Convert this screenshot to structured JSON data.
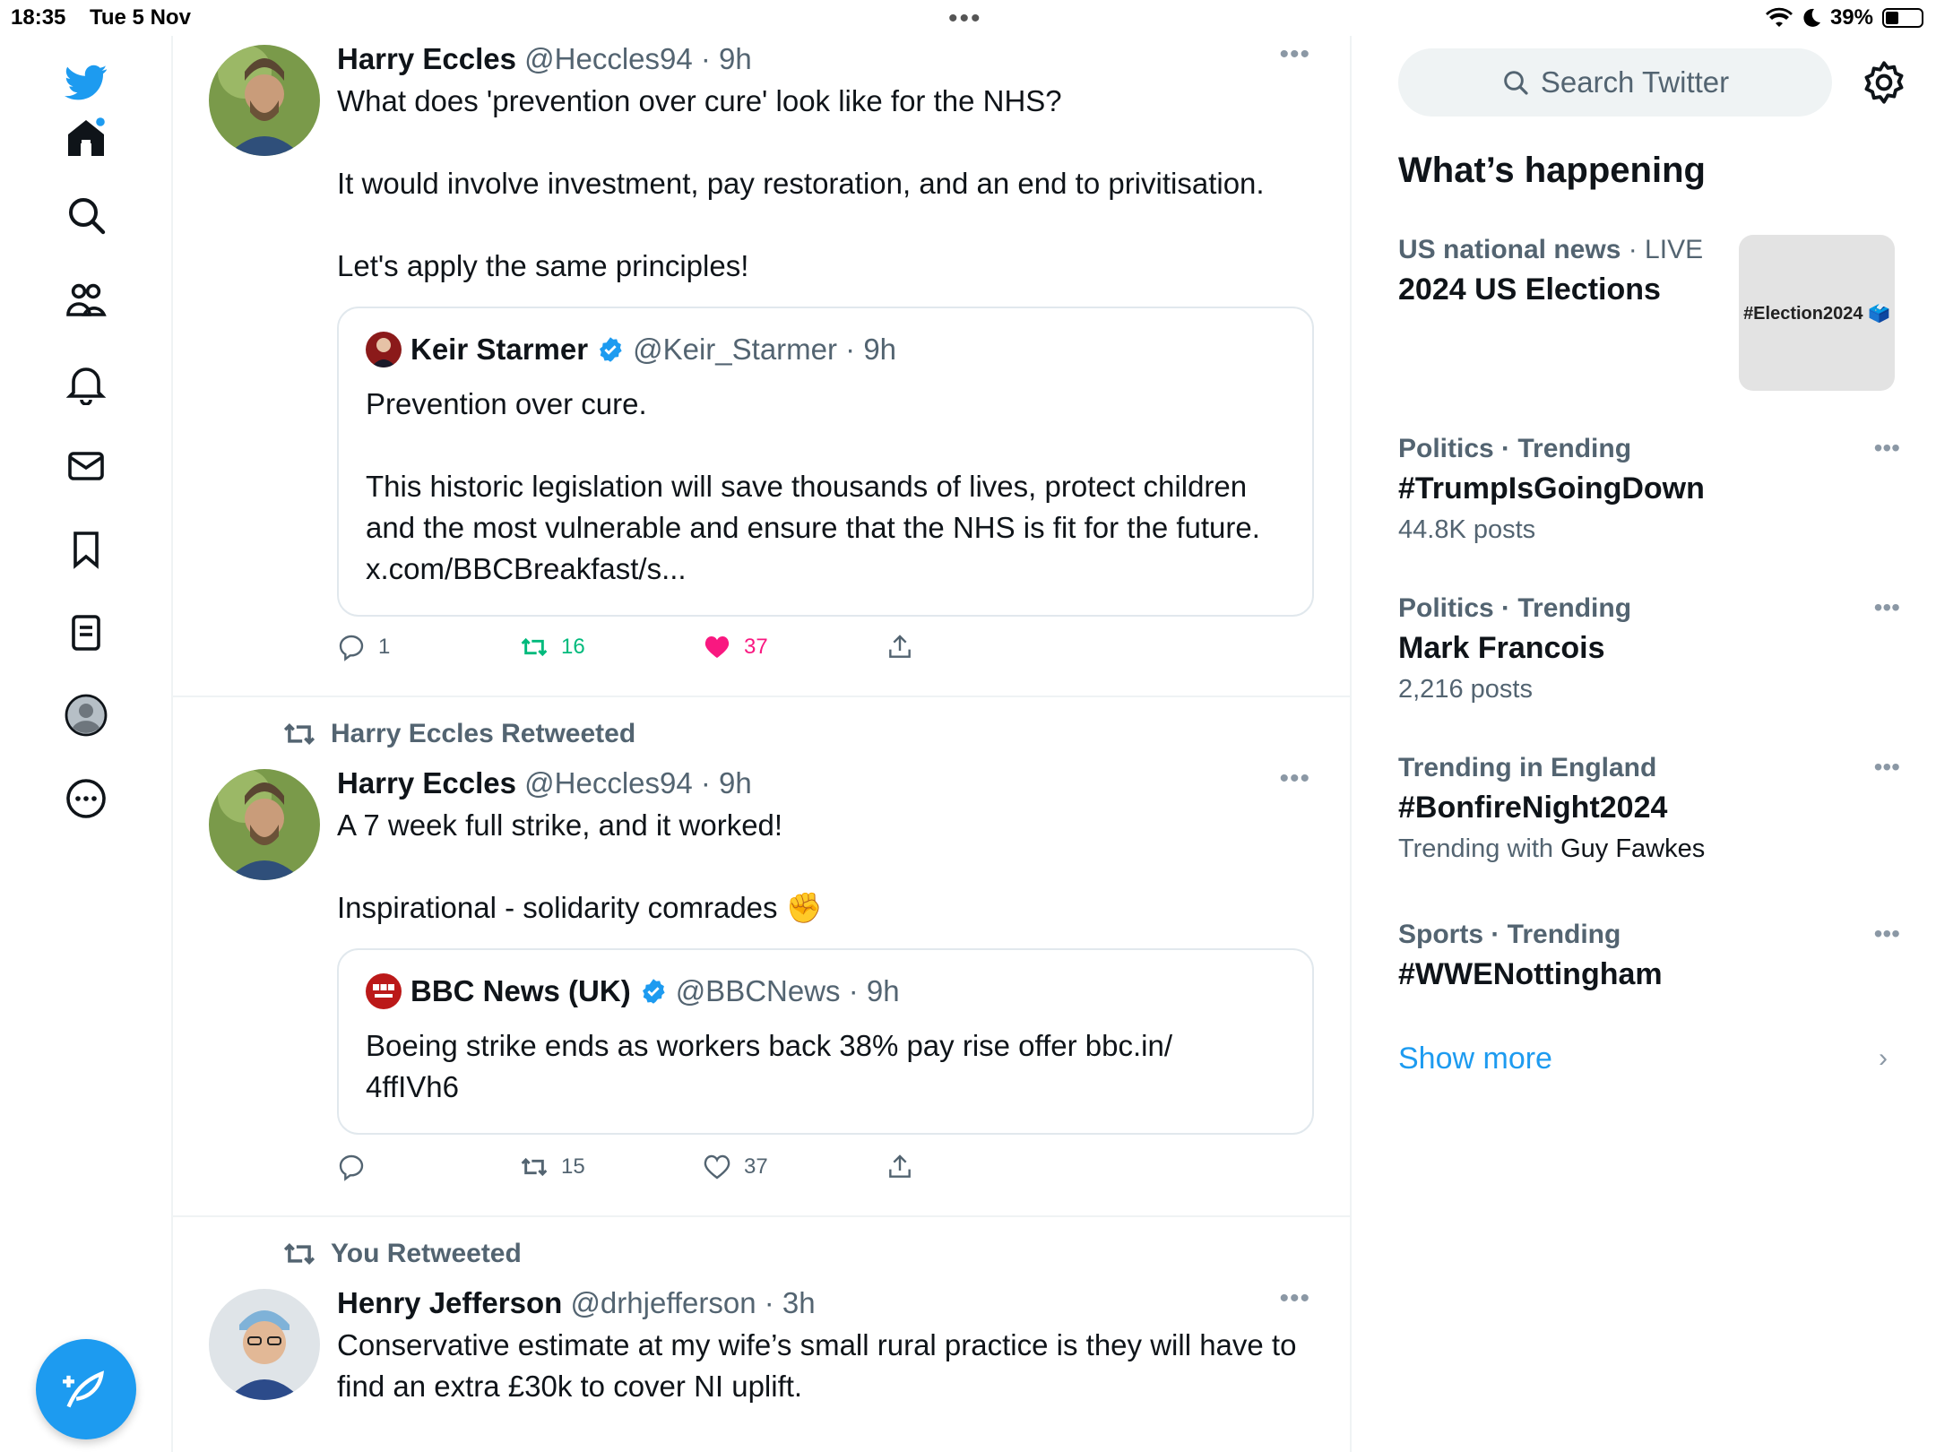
{
  "status": {
    "time": "18:35",
    "date": "Tue 5 Nov",
    "battery": "39%",
    "battery_level": 0.39
  },
  "nav": {
    "items": [
      "twitter-logo",
      "home",
      "explore",
      "communities",
      "notifications",
      "messages",
      "bookmarks",
      "lists",
      "profile",
      "more"
    ]
  },
  "search": {
    "placeholder": "Search Twitter"
  },
  "tweets": [
    {
      "name": "Harry Eccles",
      "meta": "@Heccles94 · 9h",
      "text": "What does 'prevention over cure' look like for the NHS?\n\nIt would involve investment, pay restoration, and an end to privitisation.\n\nLet's apply the same principles!",
      "quote": {
        "name": "Keir Starmer",
        "meta": "@Keir_Starmer · 9h",
        "text": "Prevention over cure.\n\nThis historic legislation will save thousands of lives, protect children and the most vulnerable and ensure that the NHS is fit for the future. x.com/BBCBreakfast/s..."
      },
      "replies": "1",
      "retweets": "16",
      "likes": "37"
    },
    {
      "retweeted_by": "Harry Eccles Retweeted",
      "name": "Harry Eccles",
      "meta": "@Heccles94 · 9h",
      "text": "A 7 week full strike, and it worked!\n\nInspirational - solidarity comrades ✊",
      "quote": {
        "name": "BBC News (UK)",
        "meta": "@BBCNews · 9h",
        "text": "Boeing strike ends as workers back 38% pay rise offer bbc.in/\n4ffIVh6"
      },
      "replies": "",
      "retweets": "15",
      "likes": "37"
    },
    {
      "retweeted_by": "You Retweeted",
      "name": "Henry Jefferson",
      "meta": "@drhjefferson · 3h",
      "text": "Conservative estimate at my wife’s small rural practice is they will have to find an extra £30k to cover NI uplift."
    }
  ],
  "sidebar": {
    "heading": "What’s happening",
    "trends": [
      {
        "category": "US national news",
        "qualifier": " · LIVE",
        "topic": "2024 US Elections",
        "image_text": "#Election2024 🗳️"
      },
      {
        "category": "Politics · Trending",
        "topic": "#TrumpIsGoingDown",
        "count": "44.8K posts"
      },
      {
        "category": "Politics · Trending",
        "topic": "Mark Francois",
        "count": "2,216 posts"
      },
      {
        "category": "Trending in England",
        "topic": "#BonfireNight2024",
        "count_prefix": "Trending with ",
        "count_name": "Guy Fawkes"
      },
      {
        "category": "Sports · Trending",
        "topic": "#WWENottingham"
      }
    ],
    "show_more": "Show more"
  },
  "colors": {
    "brand": "#1d9bf0",
    "retweet": "#00ba7c",
    "like": "#f91880"
  }
}
